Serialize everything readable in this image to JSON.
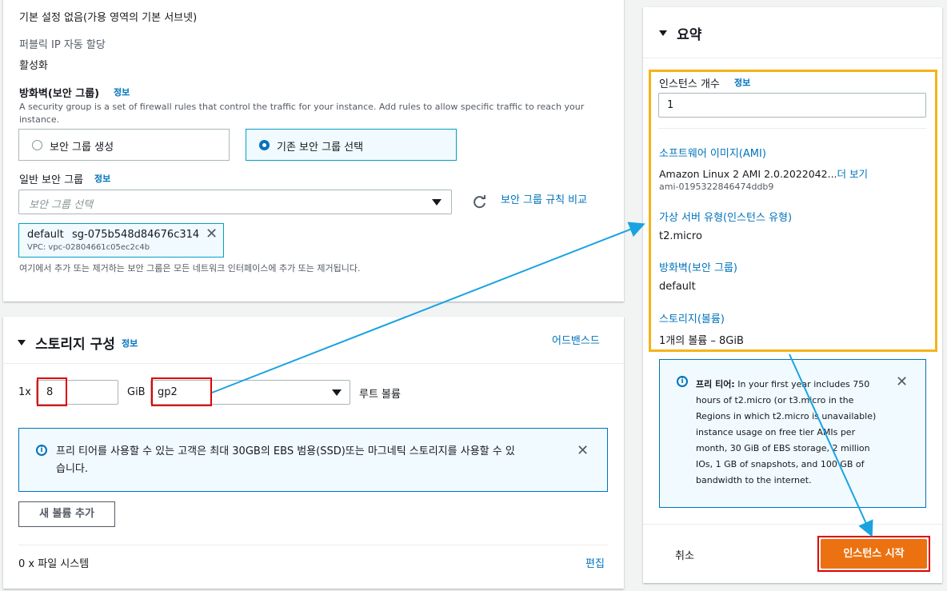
{
  "network": {
    "subnet_value": "기본 설정 없음(가용 영역의 기본 서브넷)",
    "public_ip_label": "퍼블릭 IP 자동 할당",
    "public_ip_value": "활성화",
    "firewall_label": "방화벽(보안 그룹)",
    "firewall_info": "정보",
    "firewall_desc_line1": "A security group is a set of firewall rules that control the traffic for your instance. Add rules to allow specific traffic to reach your",
    "firewall_desc_line2": "instance.",
    "radio_create": "보안 그룹 생성",
    "radio_existing": "기존 보안 그룹 선택",
    "common_sg_label": "일반 보안 그룹",
    "common_sg_info": "정보",
    "sg_select_placeholder": "보안 그룹 선택",
    "compare_rules_link": "보안 그룹 규칙 비교",
    "token_name": "default",
    "token_id": "sg-075b548d84676c314",
    "token_vpc": "VPC: vpc-02804661c05ec2c4b",
    "sg_note": "여기에서 추가 또는 제거하는 보안 그룹은 모든 네트워크 인터페이스에 추가 또는 제거됩니다."
  },
  "storage": {
    "title": "스토리지 구성",
    "info": "정보",
    "advanced_link": "어드밴스드",
    "count_prefix": "1x",
    "size_value": "8",
    "size_unit": "GiB",
    "volume_type": "gp2",
    "root_label": "루트 볼륨",
    "free_tier_line1": "프리 티어를 사용할 수 있는 고객은 최대 30GB의 EBS 범용(SSD)또는 마그네틱 스토리지를 사용할 수 있",
    "free_tier_line2": "습니다.",
    "add_volume_button": "새 볼륨 추가",
    "filesystems_label": "0 x 파일 시스템",
    "edit_link": "편집"
  },
  "summary": {
    "title": "요약",
    "instance_count_label": "인스턴스 개수",
    "instance_count_info": "정보",
    "instance_count_value": "1",
    "ami_label": "소프트웨어 이미지(AMI)",
    "ami_value": "Amazon Linux 2 AMI 2.0.2022042...",
    "ami_more": "더 보기",
    "ami_id": "ami-0195322846474ddb9",
    "instance_type_label": "가상 서버 유형(인스턴스 유형)",
    "instance_type_value": "t2.micro",
    "firewall_label": "방화벽(보안 그룹)",
    "firewall_value": "default",
    "storage_label": "스토리지(볼륨)",
    "storage_value": "1개의 볼륨 – 8GiB",
    "free_tier_title": "프리 티어:",
    "free_tier_lines": [
      "In your first year includes 750",
      "hours of t2.micro (or t3.micro in the",
      "Regions in which t2.micro is unavailable)",
      "instance usage on free tier AMIs per",
      "month, 30 GiB of EBS storage, 2 million",
      "IOs, 1 GB of snapshots, and 100 GB of",
      "bandwidth to the internet."
    ],
    "cancel_button": "취소",
    "launch_button": "인스턴스 시작"
  },
  "colors": {
    "link": "#0073bb",
    "launch": "#ec7211",
    "highlight_red": "#e00000",
    "highlight_yellow": "#f5b31a",
    "arrow": "#1aa3e0"
  }
}
